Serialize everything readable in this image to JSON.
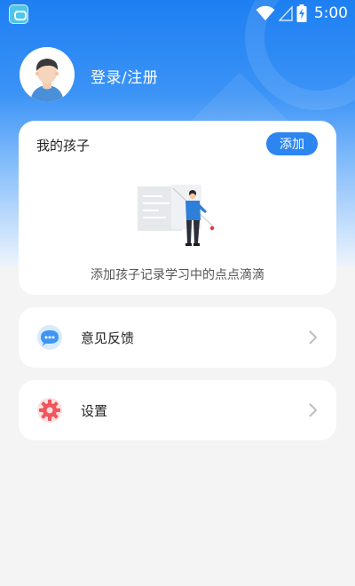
{
  "statusbar": {
    "time": "5:00",
    "icons": [
      "app-icon",
      "wifi-icon",
      "signal-icon",
      "battery-charging-icon"
    ]
  },
  "profile": {
    "login_label": "登录/注册",
    "avatar_icon": "avatar-icon"
  },
  "kids": {
    "title": "我的孩子",
    "add_label": "添加",
    "empty_text": "添加孩子记录学习中的点点滴滴",
    "illustration": "teacher-whiteboard-illustration"
  },
  "menu": [
    {
      "label": "意见反馈",
      "icon": "chat-bubble-icon"
    },
    {
      "label": "设置",
      "icon": "gear-icon"
    }
  ],
  "colors": {
    "primary": "#2d86f0",
    "background": "#f4f4f5",
    "feedback_icon": "#3e95f5",
    "settings_icon": "#f0565c"
  }
}
